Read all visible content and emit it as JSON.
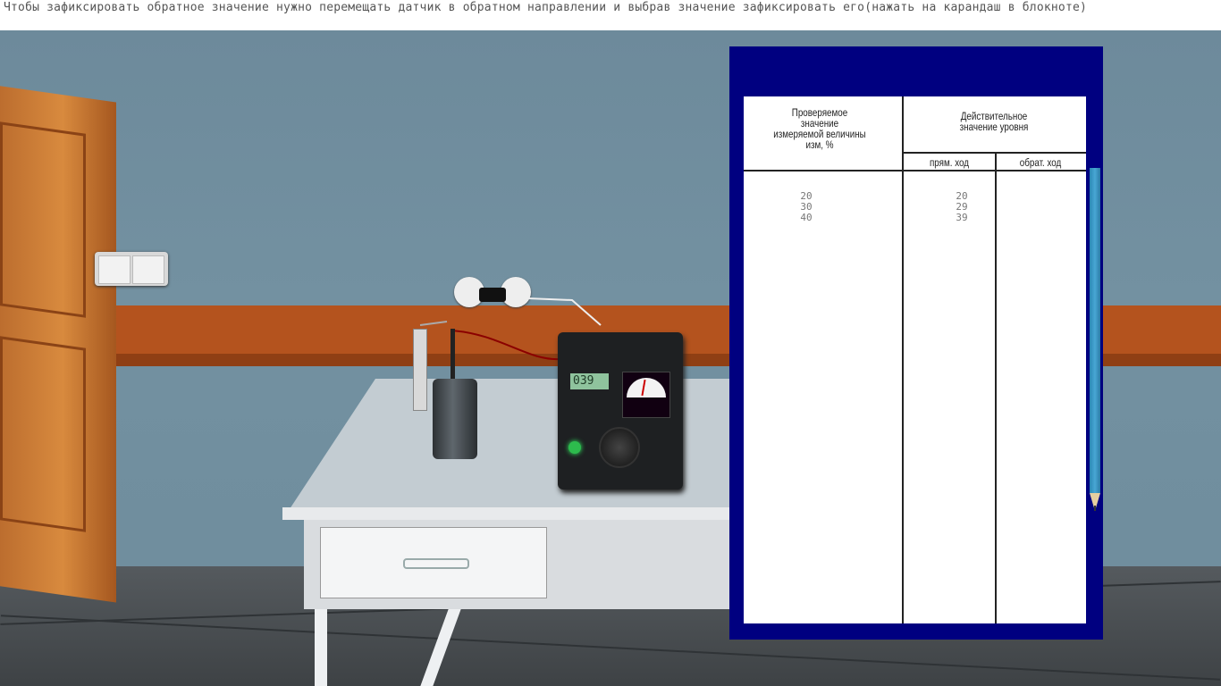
{
  "instruction": {
    "text": "Чтобы зафиксировать обратное значение нужно перемещать датчик в обратном направлении и выбрав значение зафиксировать его(нажать на карандаш в блокноте)"
  },
  "device": {
    "display_value": "039"
  },
  "notebook": {
    "header_col1": "Проверяемое\nзначение\nизмеряемой величины\nизм, %",
    "header_col2": "Действительное\nзначение уровня",
    "subheader_forward": "прям. ход",
    "subheader_reverse": "обрат. ход",
    "rows": [
      {
        "checked": "20",
        "forward": "20",
        "reverse": ""
      },
      {
        "checked": "30",
        "forward": "29",
        "reverse": ""
      },
      {
        "checked": "40",
        "forward": "39",
        "reverse": ""
      }
    ]
  },
  "colors": {
    "notebook_frame": "#000080",
    "pencil": "#3a9bc9",
    "wall": "#6f8d9d",
    "stripe": "#b4531e"
  },
  "icons": {
    "pencil": "pencil-icon"
  }
}
